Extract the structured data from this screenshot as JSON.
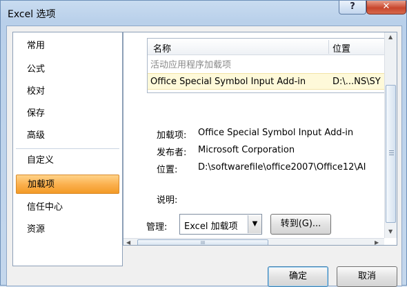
{
  "window": {
    "title": "Excel 选项",
    "help_glyph": "?",
    "close_glyph": "✕"
  },
  "nav": {
    "items": [
      {
        "label": "常用"
      },
      {
        "label": "公式"
      },
      {
        "label": "校对"
      },
      {
        "label": "保存"
      },
      {
        "label": "高级"
      },
      {
        "label": "自定义"
      },
      {
        "label": "加载项"
      },
      {
        "label": "信任中心"
      },
      {
        "label": "资源"
      }
    ],
    "selected": "加载项"
  },
  "addins": {
    "columns": [
      "名称",
      "位置"
    ],
    "section": "活动应用程序加载项",
    "rows": [
      {
        "name": "Office Special Symbol Input Add-in",
        "location": "D:\\...NS\\SY"
      }
    ]
  },
  "details": {
    "addin_label": "加载项:",
    "addin_value": "Office Special Symbol Input Add-in",
    "publisher_label": "发布者:",
    "publisher_value": "Microsoft Corporation",
    "location_label": "位置:",
    "location_value": "D:\\softwarefile\\office2007\\Office12\\AI",
    "description_label": "说明:"
  },
  "manage": {
    "label": "管理:",
    "selected": "Excel 加载项",
    "go_button": "转到(G)..."
  },
  "buttons": {
    "ok": "确定",
    "cancel": "取消"
  },
  "scrollbar": {
    "grip": "III"
  }
}
